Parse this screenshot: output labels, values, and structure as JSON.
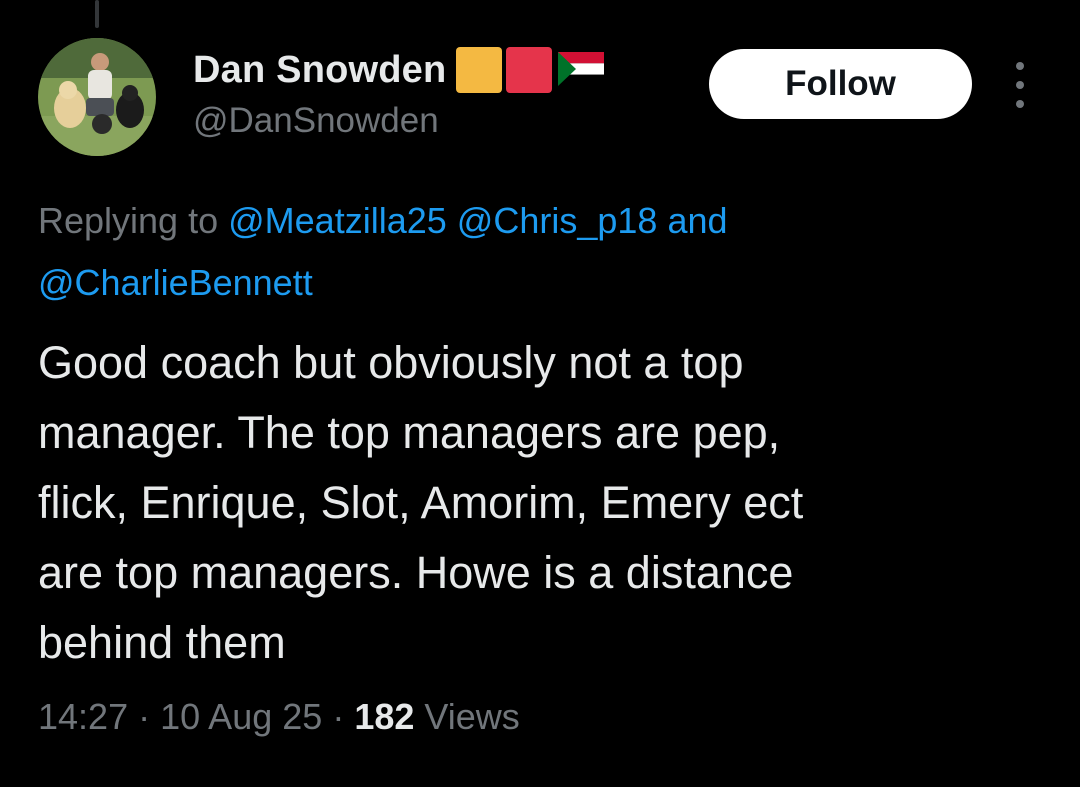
{
  "author": {
    "display_name": "Dan Snowden",
    "handle": "@DanSnowden",
    "name_emoji": [
      {
        "name": "yellow-square",
        "color": "#f4b942"
      },
      {
        "name": "red-square",
        "color": "#e5344b"
      }
    ],
    "flag_icon": "sudan-flag",
    "flag_colors": {
      "red": "#d21034",
      "white": "#ffffff",
      "black": "#000000",
      "green": "#007229"
    }
  },
  "actions": {
    "follow_label": "Follow",
    "more_icon": "more-dots-vertical-icon"
  },
  "reply_context": {
    "prefix": "Replying to",
    "mentions": [
      "@Meatzilla25",
      "@Chris_p18",
      "@CharlieBennett"
    ],
    "conjunction": "and"
  },
  "tweet": {
    "text": "Good coach but obviously not a top\nmanager. The top managers are pep,\nflick, Enrique, Slot, Amorim, Emery ect\nare top managers. Howe is a distance\nbehind them"
  },
  "meta": {
    "time": "14:27",
    "separator": "·",
    "date": "10 Aug 25",
    "views_count": "182",
    "views_label": "Views"
  },
  "colors": {
    "background": "#000000",
    "text_primary": "#e7e9ea",
    "text_secondary": "#71767b",
    "link": "#1d9bf0",
    "follow_bg": "#ffffff",
    "follow_text": "#0f1419"
  }
}
